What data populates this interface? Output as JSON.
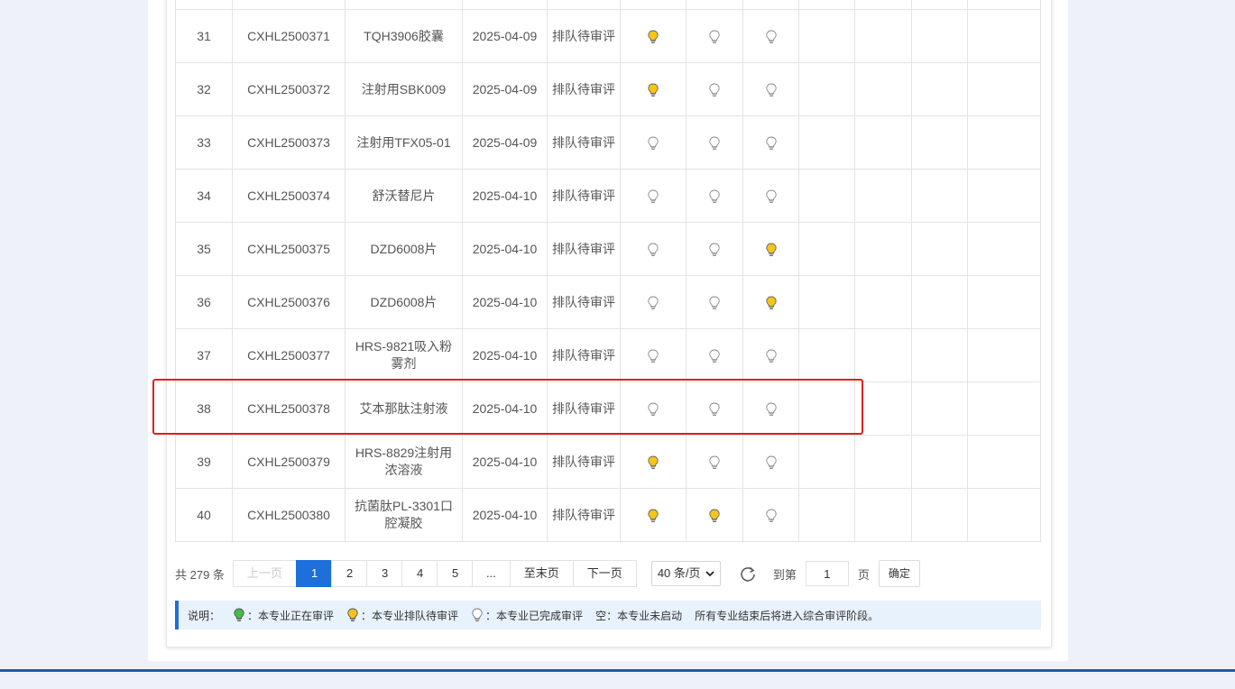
{
  "rows": [
    {
      "no": "31",
      "code": "CXHL2500371",
      "name": "TQH3906胶囊",
      "date": "2025-04-09",
      "status": "排队待审评",
      "s1": "queue",
      "s2": "done",
      "s3": "done"
    },
    {
      "no": "32",
      "code": "CXHL2500372",
      "name": "注射用SBK009",
      "date": "2025-04-09",
      "status": "排队待审评",
      "s1": "queue",
      "s2": "done",
      "s3": "done"
    },
    {
      "no": "33",
      "code": "CXHL2500373",
      "name": "注射用TFX05-01",
      "date": "2025-04-09",
      "status": "排队待审评",
      "s1": "done",
      "s2": "done",
      "s3": "done"
    },
    {
      "no": "34",
      "code": "CXHL2500374",
      "name": "舒沃替尼片",
      "date": "2025-04-10",
      "status": "排队待审评",
      "s1": "done",
      "s2": "done",
      "s3": "done"
    },
    {
      "no": "35",
      "code": "CXHL2500375",
      "name": "DZD6008片",
      "date": "2025-04-10",
      "status": "排队待审评",
      "s1": "done",
      "s2": "done",
      "s3": "queue"
    },
    {
      "no": "36",
      "code": "CXHL2500376",
      "name": "DZD6008片",
      "date": "2025-04-10",
      "status": "排队待审评",
      "s1": "done",
      "s2": "done",
      "s3": "queue"
    },
    {
      "no": "37",
      "code": "CXHL2500377",
      "name": "HRS-9821吸入粉雾剂",
      "date": "2025-04-10",
      "status": "排队待审评",
      "s1": "done",
      "s2": "done",
      "s3": "done"
    },
    {
      "no": "38",
      "code": "CXHL2500378",
      "name": "艾本那肽注射液",
      "date": "2025-04-10",
      "status": "排队待审评",
      "s1": "done",
      "s2": "done",
      "s3": "done"
    },
    {
      "no": "39",
      "code": "CXHL2500379",
      "name": "HRS-8829注射用浓溶液",
      "date": "2025-04-10",
      "status": "排队待审评",
      "s1": "queue",
      "s2": "done",
      "s3": "done"
    },
    {
      "no": "40",
      "code": "CXHL2500380",
      "name": "抗菌肽PL-3301口腔凝胶",
      "date": "2025-04-10",
      "status": "排队待审评",
      "s1": "queue",
      "s2": "queue",
      "s3": "done"
    }
  ],
  "pagination": {
    "total": "共 279 条",
    "prev": "上一页",
    "pages": [
      "1",
      "2",
      "3",
      "4",
      "5"
    ],
    "current": "1",
    "ellipsis": "...",
    "last": "至末页",
    "next": "下一页",
    "page_size": "40 条/页",
    "goto_label": "到第",
    "goto_value": "1",
    "page_word": "页",
    "confirm": "确定"
  },
  "legend": {
    "title": "说明：",
    "reviewing": "：本专业正在审评",
    "queued": "：本专业排队待审评",
    "done": "：本专业已完成审评",
    "empty": "空：本专业未启动",
    "note": "所有专业结束后将进入综合审评阶段。"
  },
  "colors": {
    "accent": "#1e6fd9",
    "highlight": "#e02020",
    "bulb_queue": "#f5c518",
    "bulb_reviewing": "#3fbf4a",
    "bulb_done": "#ffffff"
  }
}
